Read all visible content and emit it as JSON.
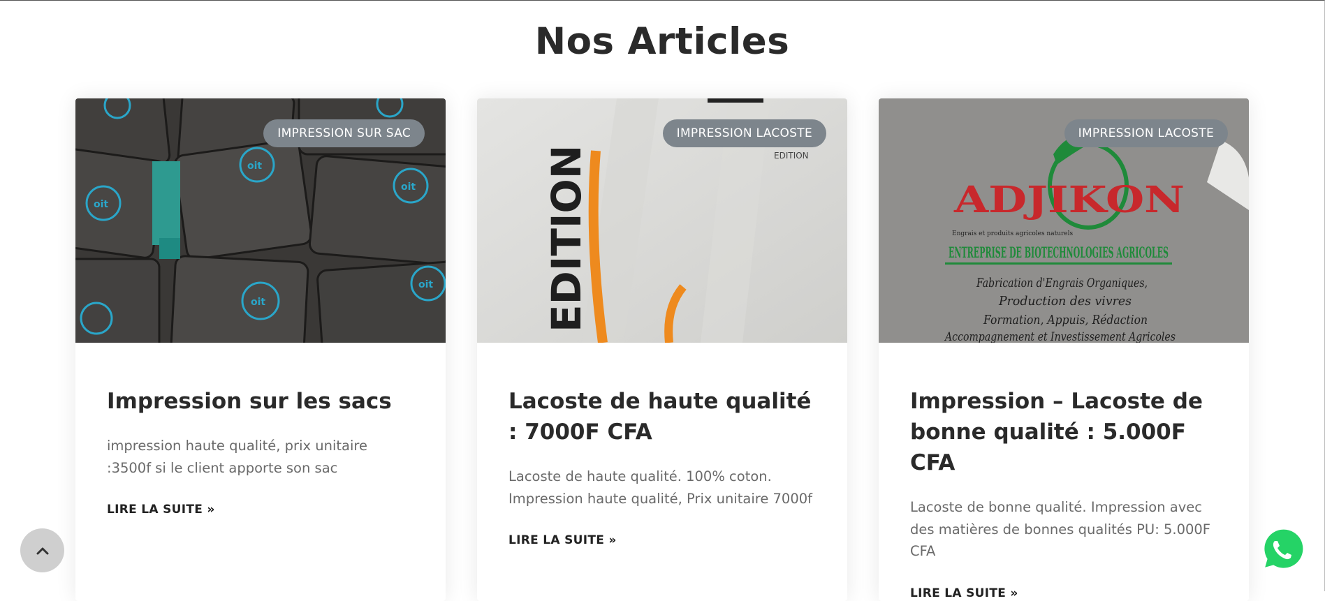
{
  "section": {
    "title": "Nos Articles"
  },
  "articles": [
    {
      "category": "IMPRESSION SUR SAC",
      "title": "Impression sur les sacs",
      "excerpt": "impression haute qualité, prix unitaire :3500f si le client apporte son sac",
      "read_more": "LIRE LA SUITE »"
    },
    {
      "category": "IMPRESSION LACOSTE",
      "title": "Lacoste de haute qualité : 7000F CFA",
      "excerpt": "Lacoste de haute qualité. 100% coton. Impression haute qualité, Prix unitaire 7000f",
      "read_more": "LIRE LA SUITE »"
    },
    {
      "category": "IMPRESSION LACOSTE",
      "title": "Impression – Lacoste de bonne qualité : 5.000F CFA",
      "excerpt": "Lacoste de bonne qualité. Impression avec des matières de bonnes qualités PU: 5.000F CFA",
      "read_more": "LIRE LA SUITE »"
    }
  ],
  "photo_texts": {
    "shirt_print": "EDITION",
    "shirt_small": "EDITION",
    "logo": "ADJIKON",
    "logo_sub": "Engrais et produits agricoles naturels",
    "company": "ENTREPRISE DE BIOTECHNOLOGIES AGRICOLES",
    "line1": "Fabrication d'Engrais Organiques,",
    "line2": "Production des vivres",
    "line3": "Formation, Appuis, Rédaction",
    "line4": "Accompagnement et Investissement Agricoles"
  },
  "icons": {
    "scroll_top": "chevron-up-icon",
    "whatsapp": "whatsapp-icon"
  },
  "colors": {
    "badge": "#7d858c",
    "whatsapp": "#25d366",
    "scroll_top": "#cfcfcf"
  }
}
